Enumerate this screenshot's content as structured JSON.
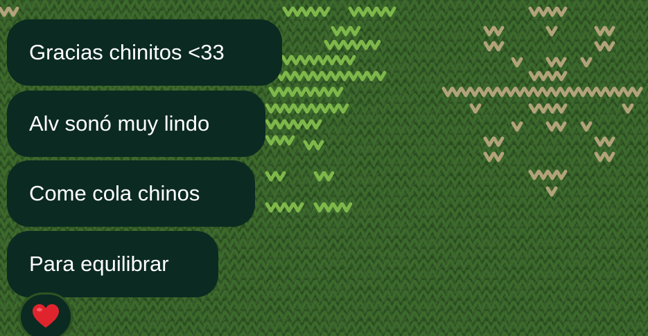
{
  "chat": {
    "messages": [
      {
        "text": "Gracias chinitos <33"
      },
      {
        "text": "Alv sonó muy lindo"
      },
      {
        "text": "Come cola chinos"
      },
      {
        "text": "Para equilibrar"
      }
    ],
    "reaction": {
      "icon": "red-heart-icon",
      "emoji": "❤️"
    }
  },
  "colors": {
    "bubble": "#0b2a22",
    "bubble_text": "#ffffff",
    "wallpaper": "#2e5422",
    "pattern_light_green": "#7fb84a",
    "pattern_beige": "#b3a37a"
  }
}
